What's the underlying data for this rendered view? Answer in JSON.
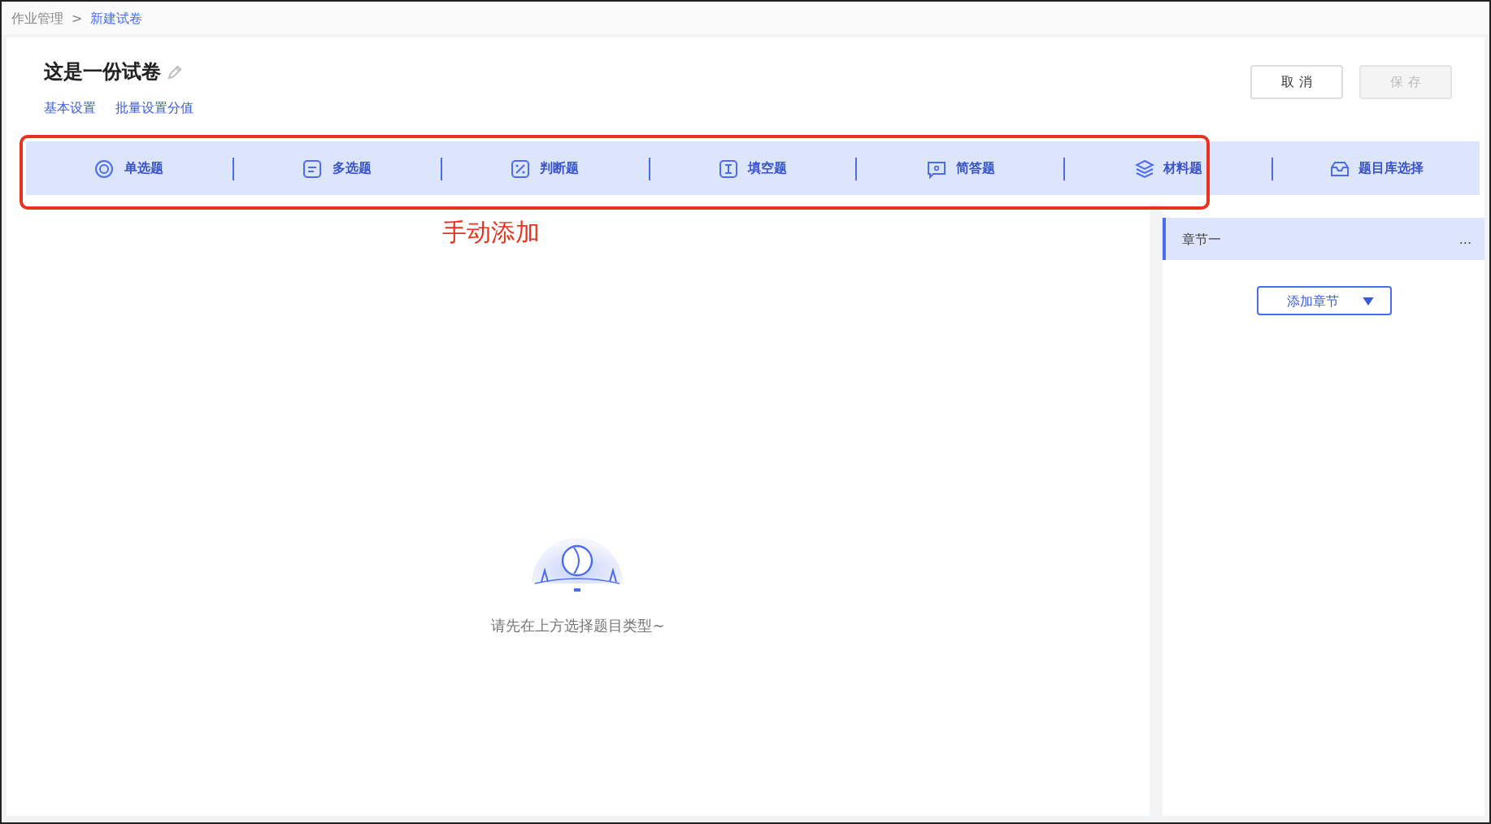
{
  "breadcrumb": [
    {
      "label": "作业管理",
      "selected": false
    },
    {
      "label": "新建试卷",
      "selected": true
    }
  ],
  "breadcrumb_separator": ">",
  "paper": {
    "title": "这是一份试卷",
    "links": [
      "基本设置",
      "批量设置分值"
    ]
  },
  "buttons": [
    {
      "label": "取 消",
      "disabled": false
    },
    {
      "label": "保 存",
      "disabled": true
    }
  ],
  "question_types": [
    {
      "label": "单选题",
      "kind": "single"
    },
    {
      "label": "多选题",
      "kind": "multiple"
    },
    {
      "label": "判断题",
      "kind": "judge"
    },
    {
      "label": "填空题",
      "kind": "blank"
    },
    {
      "label": "简答题",
      "kind": "short"
    },
    {
      "label": "材料题",
      "kind": "material"
    },
    {
      "label": "题目库选择",
      "kind": "bank"
    }
  ],
  "annotation": {
    "label": "手动添加"
  },
  "chapters": [
    {
      "label": "章节一",
      "more": "...",
      "selected": true
    }
  ],
  "add_chapter": {
    "label": "添加章节"
  },
  "empty_state": {
    "message": "请先在上方选择题目类型~"
  }
}
